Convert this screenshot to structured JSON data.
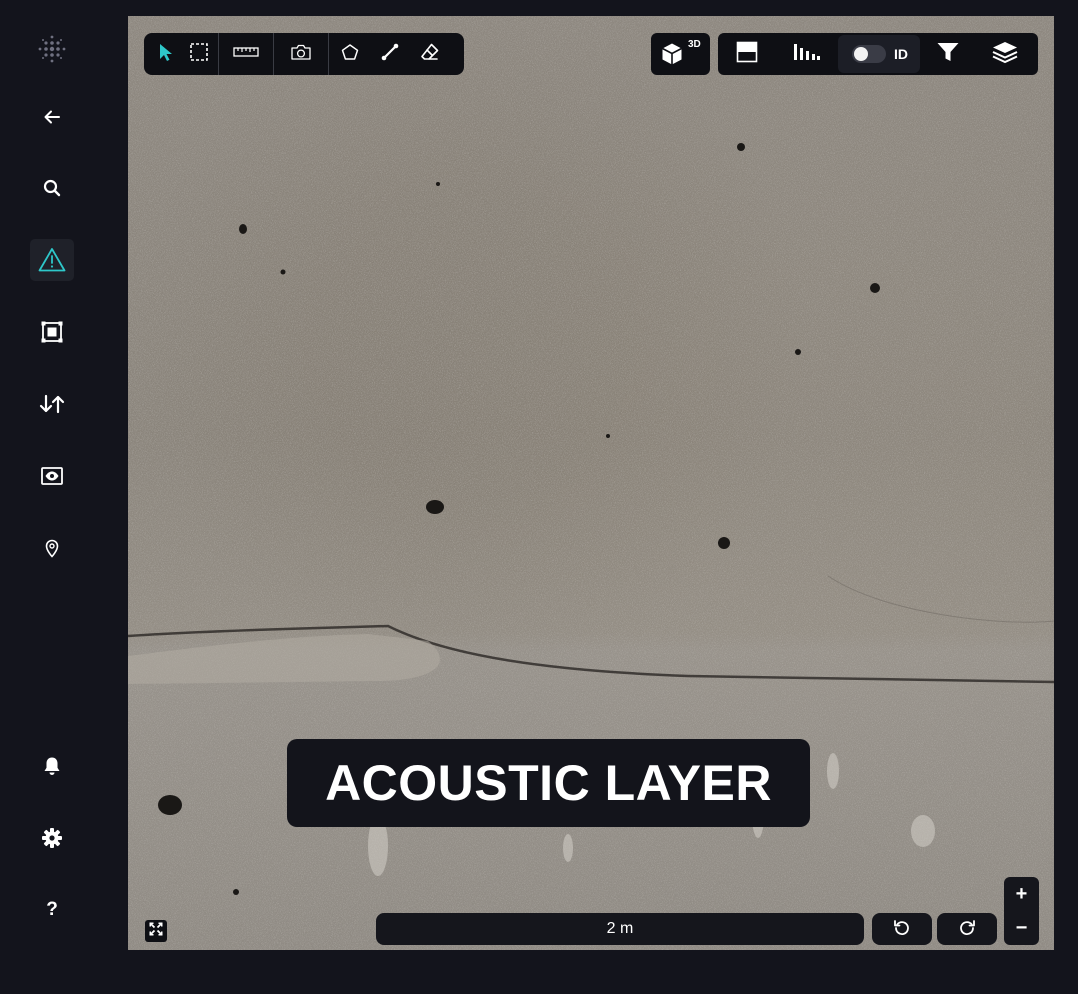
{
  "sidebar": {
    "items": [
      {
        "name": "back",
        "icon": "arrow-left-icon"
      },
      {
        "name": "search",
        "icon": "search-icon"
      },
      {
        "name": "alerts",
        "icon": "warning-triangle-icon",
        "active": true
      },
      {
        "name": "frame",
        "icon": "frame-focus-icon"
      },
      {
        "name": "sort",
        "icon": "sort-arrows-icon"
      },
      {
        "name": "view",
        "icon": "eye-card-icon"
      },
      {
        "name": "location",
        "icon": "map-pin-icon"
      },
      {
        "name": "notifications",
        "icon": "bell-icon"
      },
      {
        "name": "settings",
        "icon": "gear-icon"
      },
      {
        "name": "help",
        "label": "?",
        "icon": "help-icon"
      }
    ],
    "accent_color": "#2ec7c9"
  },
  "toolbar": {
    "tools": [
      "pointer-icon",
      "marquee-select-icon",
      "ruler-icon",
      "camera-icon",
      "polygon-icon",
      "line-icon",
      "eraser-icon"
    ],
    "badge_3d": "3D",
    "toggle_label": "ID",
    "toggle_on": false
  },
  "banner": {
    "title": "ACOUSTIC LAYER"
  },
  "map": {
    "scale_label": "2 m"
  },
  "zoom": {
    "in_label": "+",
    "out_label": "−"
  }
}
